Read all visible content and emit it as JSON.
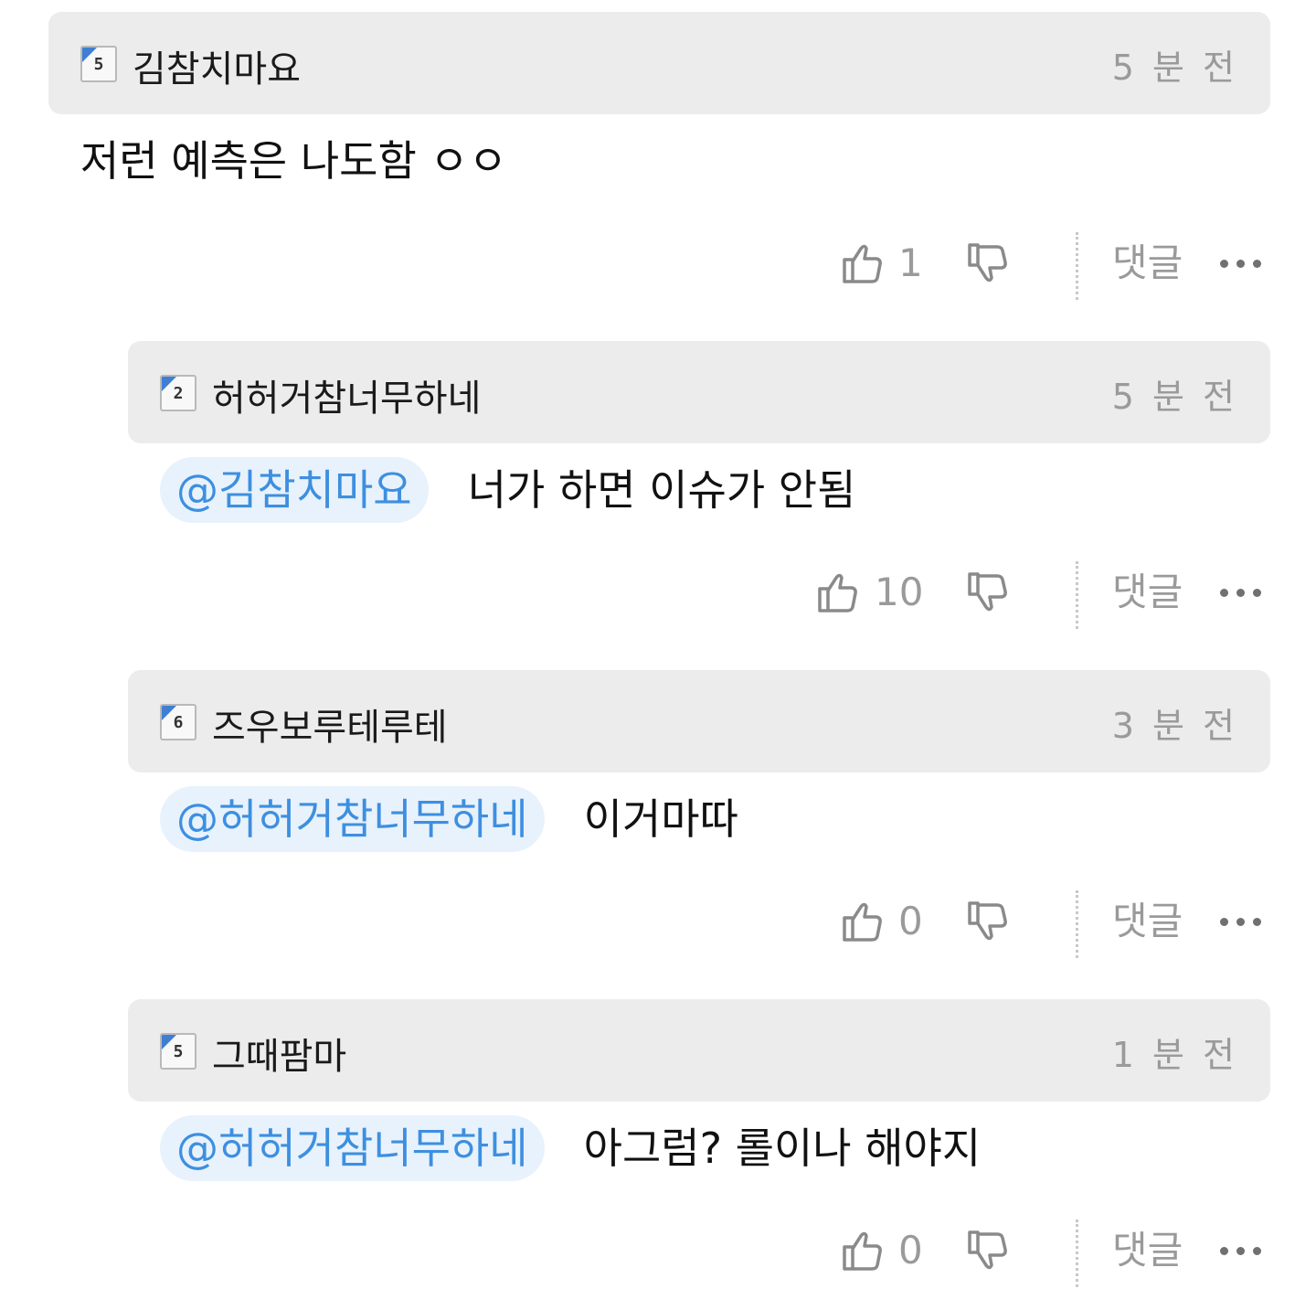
{
  "colors": {
    "header_bg": "#ececec",
    "mention_bg": "#e8f2fc",
    "mention_text": "#3d8fe0",
    "meta_gray": "#9a9a9a",
    "badge_blue": "#3f7fd3"
  },
  "comments": [
    {
      "level": "5",
      "username": "김참치마요",
      "time": "5 분 전",
      "mention": "",
      "content": "저런 예측은 나도함 ㅇㅇ",
      "likes": "1",
      "reply_label": "댓글",
      "like_icon": "thumbs-up-icon",
      "dislike_icon": "thumbs-down-icon",
      "more_icon": "more-dots-icon"
    },
    {
      "level": "2",
      "username": "허허거참너무하네",
      "time": "5 분 전",
      "mention": "@김참치마요",
      "content": "너가 하면 이슈가 안됨",
      "likes": "10",
      "reply_label": "댓글"
    },
    {
      "level": "6",
      "username": "즈우보루테루테",
      "time": "3 분 전",
      "mention": "@허허거참너무하네",
      "content": "이거마따",
      "likes": "0",
      "reply_label": "댓글"
    },
    {
      "level": "5",
      "username": "그때팜마",
      "time": "1 분 전",
      "mention": "@허허거참너무하네",
      "content": "아그럼? 롤이나 해야지",
      "likes": "0",
      "reply_label": "댓글"
    }
  ]
}
